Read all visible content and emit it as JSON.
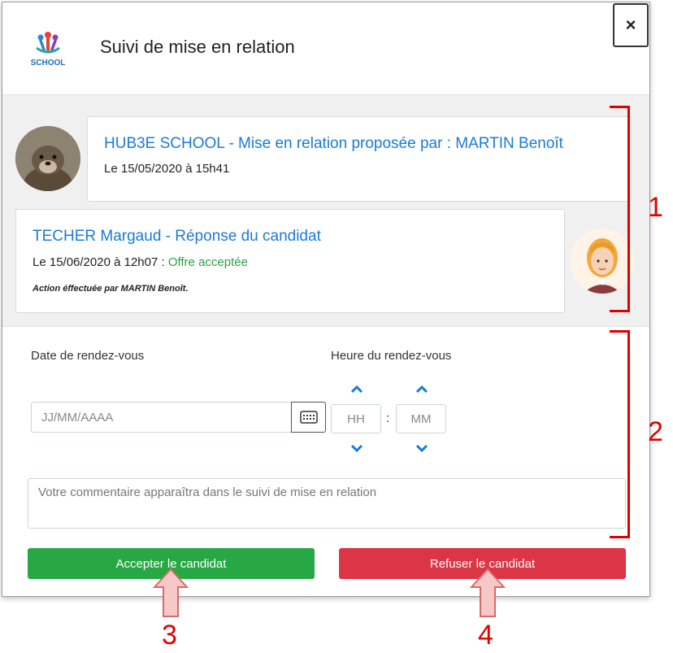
{
  "header": {
    "title": "Suivi de mise en relation",
    "logo_text": "SCHOOL",
    "close_label": "×"
  },
  "timeline": {
    "entries": [
      {
        "title": "HUB3E SCHOOL - Mise en relation proposée par : MARTIN Benoît",
        "date": "Le 15/05/2020 à 15h41"
      },
      {
        "title": "TECHER Margaud - Réponse du candidat",
        "date": "Le 15/06/2020 à 12h07 : ",
        "status": "Offre acceptée",
        "note": "Action éffectuée par MARTIN Benoît."
      }
    ]
  },
  "form": {
    "date_label": "Date de rendez-vous",
    "date_placeholder": "JJ/MM/AAAA",
    "time_label": "Heure du rendez-vous",
    "hour_placeholder": "HH",
    "minute_placeholder": "MM",
    "separator": ":",
    "comment_placeholder": "Votre commentaire apparaîtra dans le suivi de mise en relation",
    "accept_label": "Accepter le candidat",
    "refuse_label": "Refuser le candidat"
  },
  "annotations": {
    "n1": "1",
    "n2": "2",
    "n3": "3",
    "n4": "4"
  },
  "colors": {
    "accent": "#1a7bd6",
    "success": "#28a745",
    "danger": "#dc3545",
    "status_green": "#2e9e44",
    "annotation_red": "#e00000"
  }
}
